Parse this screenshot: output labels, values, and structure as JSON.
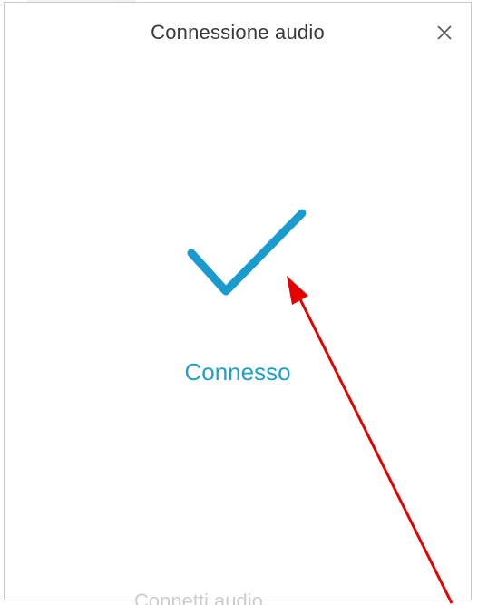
{
  "dialog": {
    "title": "Connessione audio",
    "close_icon": "close-icon",
    "status_text": "Connesso",
    "status_icon": "checkmark-icon",
    "background_footer_text": "Connetti audio"
  },
  "colors": {
    "accent": "#1ea0cc",
    "checkmark": "#1a9bd0",
    "annotation": "#e60000",
    "title": "#3a3a3a"
  },
  "background": {
    "edit_icon": "pencil-icon",
    "phone_icon": "phone-hangup-icon"
  },
  "annotation": {
    "type": "arrow",
    "target": "checkmark-icon"
  }
}
